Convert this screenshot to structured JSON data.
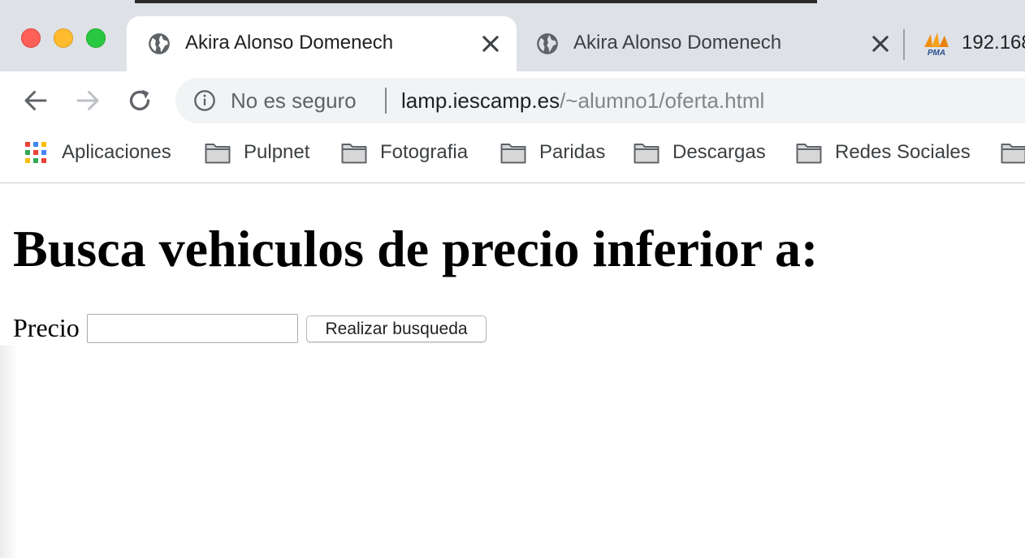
{
  "browser": {
    "tabs": [
      {
        "title": "Akira Alonso Domenech",
        "favicon": "globe-icon",
        "active": true
      },
      {
        "title": "Akira Alonso Domenech",
        "favicon": "globe-icon",
        "active": false
      },
      {
        "title": "192.168",
        "favicon": "phpmyadmin-logo",
        "active": false
      }
    ],
    "pma_logo_text": "PMA",
    "security_label": "No es seguro",
    "url_host": "lamp.iescamp.es",
    "url_path": "/~alumno1/oferta.html"
  },
  "bookmarks": [
    {
      "label": "Aplicaciones",
      "icon": "apps-grid-icon"
    },
    {
      "label": "Pulpnet",
      "icon": "folder-icon"
    },
    {
      "label": "Fotografia",
      "icon": "folder-icon"
    },
    {
      "label": "Paridas",
      "icon": "folder-icon"
    },
    {
      "label": "Descargas",
      "icon": "folder-icon"
    },
    {
      "label": "Redes Sociales",
      "icon": "folder-icon"
    }
  ],
  "page": {
    "heading": "Busca vehiculos de precio inferior a:",
    "price_label": "Precio",
    "price_value": "",
    "submit_label": "Realizar busqueda"
  },
  "colors": {
    "tabstrip_bg": "#dee1e6",
    "omnibox_bg": "#f1f3f4",
    "close_red": "#fe5f57",
    "minimize_yellow": "#febc2e",
    "zoom_green": "#28c840"
  }
}
